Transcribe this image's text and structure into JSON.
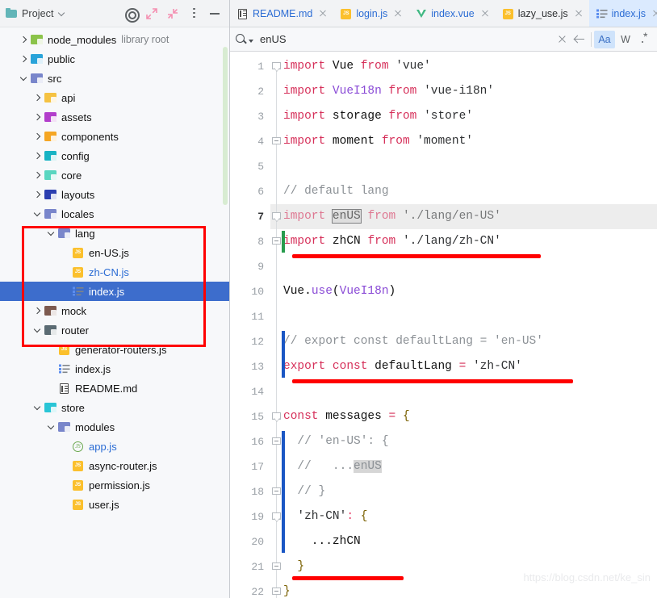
{
  "project_panel": {
    "title": "Project",
    "icons": {
      "folder": "folder-icon",
      "chevron": "chevron-down-icon",
      "locate": "locate-target-icon",
      "expand_all": "expand-all-icon",
      "collapse_all": "collapse-all-icon",
      "options": "kebab-menu-icon",
      "hide": "minimize-icon"
    },
    "tree": [
      {
        "label": "node_modules",
        "sub": "library root",
        "depth": 1,
        "arrow": "closed",
        "icon": "folder-node",
        "color": "#8bc34a",
        "selected": false,
        "blue": false
      },
      {
        "label": "public",
        "sub": "",
        "depth": 1,
        "arrow": "closed",
        "icon": "folder-public",
        "color": "#29a3d9",
        "selected": false,
        "blue": false
      },
      {
        "label": "src",
        "sub": "",
        "depth": 1,
        "arrow": "open",
        "icon": "folder-src",
        "color": "#7986cb",
        "selected": false,
        "blue": false
      },
      {
        "label": "api",
        "sub": "",
        "depth": 2,
        "arrow": "closed",
        "icon": "folder-api",
        "color": "#f5c242",
        "selected": false,
        "blue": false
      },
      {
        "label": "assets",
        "sub": "",
        "depth": 2,
        "arrow": "closed",
        "icon": "folder-assets",
        "color": "#b23ecb",
        "selected": false,
        "blue": false
      },
      {
        "label": "components",
        "sub": "",
        "depth": 2,
        "arrow": "closed",
        "icon": "folder-components",
        "color": "#f5a623",
        "selected": false,
        "blue": false
      },
      {
        "label": "config",
        "sub": "",
        "depth": 2,
        "arrow": "closed",
        "icon": "folder-config",
        "color": "#17b3c4",
        "selected": false,
        "blue": false
      },
      {
        "label": "core",
        "sub": "",
        "depth": 2,
        "arrow": "closed",
        "icon": "folder-core",
        "color": "#59d6c0",
        "selected": false,
        "blue": false
      },
      {
        "label": "layouts",
        "sub": "",
        "depth": 2,
        "arrow": "closed",
        "icon": "folder-layouts",
        "color": "#2b3eb0",
        "selected": false,
        "blue": false
      },
      {
        "label": "locales",
        "sub": "",
        "depth": 2,
        "arrow": "open",
        "icon": "folder-locales",
        "color": "#7986cb",
        "selected": false,
        "blue": false
      },
      {
        "label": "lang",
        "sub": "",
        "depth": 3,
        "arrow": "open",
        "icon": "folder-lang",
        "color": "#7986cb",
        "selected": false,
        "blue": false
      },
      {
        "label": "en-US.js",
        "sub": "",
        "depth": 4,
        "arrow": "none",
        "icon": "js-file",
        "color": "#fbc02d",
        "selected": false,
        "blue": false
      },
      {
        "label": "zh-CN.js",
        "sub": "",
        "depth": 4,
        "arrow": "none",
        "icon": "js-file",
        "color": "#fbc02d",
        "selected": false,
        "blue": true
      },
      {
        "label": "index.js",
        "sub": "",
        "depth": 4,
        "arrow": "none",
        "icon": "index-list-file",
        "color": "#5b8def",
        "selected": true,
        "blue": true
      },
      {
        "label": "mock",
        "sub": "",
        "depth": 2,
        "arrow": "closed",
        "icon": "folder-mock",
        "color": "#7d5a4f",
        "selected": false,
        "blue": false
      },
      {
        "label": "router",
        "sub": "",
        "depth": 2,
        "arrow": "open",
        "icon": "folder-router",
        "color": "#5b6b73",
        "selected": false,
        "blue": false
      },
      {
        "label": "generator-routers.js",
        "sub": "",
        "depth": 3,
        "arrow": "none",
        "icon": "js-file",
        "color": "#fbc02d",
        "selected": false,
        "blue": false
      },
      {
        "label": "index.js",
        "sub": "",
        "depth": 3,
        "arrow": "none",
        "icon": "index-list-file",
        "color": "#5b8def",
        "selected": false,
        "blue": false
      },
      {
        "label": "README.md",
        "sub": "",
        "depth": 3,
        "arrow": "none",
        "icon": "markdown-file",
        "color": "#4a4a4a",
        "selected": false,
        "blue": false
      },
      {
        "label": "store",
        "sub": "",
        "depth": 2,
        "arrow": "open",
        "icon": "folder-store",
        "color": "#29c5d6",
        "selected": false,
        "blue": false
      },
      {
        "label": "modules",
        "sub": "",
        "depth": 3,
        "arrow": "open",
        "icon": "folder-modules",
        "color": "#7986cb",
        "selected": false,
        "blue": false
      },
      {
        "label": "app.js",
        "sub": "",
        "depth": 4,
        "arrow": "none",
        "icon": "nodejs-file",
        "color": "#6aa84f",
        "selected": false,
        "blue": true
      },
      {
        "label": "async-router.js",
        "sub": "",
        "depth": 4,
        "arrow": "none",
        "icon": "js-file",
        "color": "#fbc02d",
        "selected": false,
        "blue": false
      },
      {
        "label": "permission.js",
        "sub": "",
        "depth": 4,
        "arrow": "none",
        "icon": "js-file",
        "color": "#fbc02d",
        "selected": false,
        "blue": false
      },
      {
        "label": "user.js",
        "sub": "",
        "depth": 4,
        "arrow": "none",
        "icon": "js-file",
        "color": "#fbc02d",
        "selected": false,
        "blue": false
      }
    ],
    "annotation_box_color": "#ff0000"
  },
  "editor": {
    "tabs": [
      {
        "label": "README.md",
        "icon": "markdown-file-icon",
        "active": false,
        "color": "#2b6cd4"
      },
      {
        "label": "login.js",
        "icon": "js-file-icon",
        "active": false,
        "color": "#2b6cd4"
      },
      {
        "label": "index.vue",
        "icon": "vue-file-icon",
        "active": false,
        "color": "#2b6cd4"
      },
      {
        "label": "lazy_use.js",
        "icon": "js-file-icon",
        "active": false,
        "color": "#2f3133"
      },
      {
        "label": "index.js",
        "icon": "index-list-file-icon",
        "active": true,
        "color": "#2b6cd4"
      }
    ],
    "search": {
      "value": "enUS",
      "placeholder": "Search",
      "match_case_label": "Aa",
      "words_label": "W",
      "regex_label": "regex-icon",
      "match_case_active": true
    },
    "current_line": 7,
    "lines": [
      {
        "n": 1,
        "text": "import Vue from 'vue'"
      },
      {
        "n": 2,
        "text": "import VueI18n from 'vue-i18n'"
      },
      {
        "n": 3,
        "text": "import storage from 'store'"
      },
      {
        "n": 4,
        "text": "import moment from 'moment'"
      },
      {
        "n": 5,
        "text": ""
      },
      {
        "n": 6,
        "text": "// default lang"
      },
      {
        "n": 7,
        "text": "import enUS from './lang/en-US'"
      },
      {
        "n": 8,
        "text": "import zhCN from './lang/zh-CN'"
      },
      {
        "n": 9,
        "text": ""
      },
      {
        "n": 10,
        "text": "Vue.use(VueI18n)"
      },
      {
        "n": 11,
        "text": ""
      },
      {
        "n": 12,
        "text": "// export const defaultLang = 'en-US'"
      },
      {
        "n": 13,
        "text": "export const defaultLang = 'zh-CN'"
      },
      {
        "n": 14,
        "text": ""
      },
      {
        "n": 15,
        "text": "const messages = {"
      },
      {
        "n": 16,
        "text": "  // 'en-US': {"
      },
      {
        "n": 17,
        "text": "  //   ...enUS"
      },
      {
        "n": 18,
        "text": "  // }"
      },
      {
        "n": 19,
        "text": "  'zh-CN': {"
      },
      {
        "n": 20,
        "text": "    ...zhCN"
      },
      {
        "n": 21,
        "text": "  }"
      },
      {
        "n": 22,
        "text": "}"
      }
    ],
    "highlight_token": "enUS",
    "annotation_color": "#ff0000"
  },
  "watermark": "https://blog.csdn.net/ke_sin"
}
